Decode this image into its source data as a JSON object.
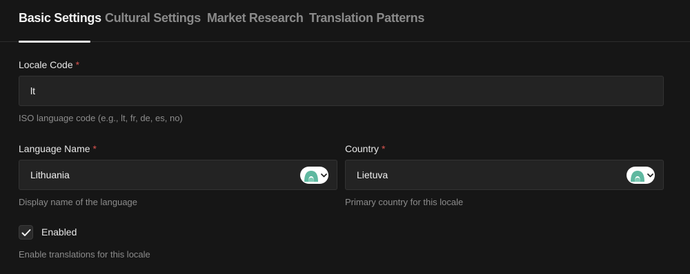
{
  "tabs": [
    {
      "label": "Basic Settings",
      "active": true
    },
    {
      "label": "Cultural Settings",
      "active": false
    },
    {
      "label": "Market Research",
      "active": false
    },
    {
      "label": "Translation Patterns",
      "active": false
    }
  ],
  "locale_code": {
    "label": "Locale Code",
    "required_mark": "*",
    "value": "lt",
    "helper": "ISO language code (e.g., lt, fr, de, es, no)"
  },
  "language_name": {
    "label": "Language Name",
    "required_mark": "*",
    "value": "Lithuania",
    "helper": "Display name of the language"
  },
  "country": {
    "label": "Country",
    "required_mark": "*",
    "value": "Lietuva",
    "helper": "Primary country for this locale"
  },
  "enabled": {
    "label": "Enabled",
    "checked": true,
    "helper": "Enable translations for this locale"
  },
  "colors": {
    "background": "#161616",
    "input_bg": "#232323",
    "required": "#d9534f",
    "badge_icon": "#5fb8a0"
  },
  "icons": {
    "badge": "assistant-logo-icon",
    "dropdown": "chevron-down-icon",
    "check": "check-icon"
  }
}
